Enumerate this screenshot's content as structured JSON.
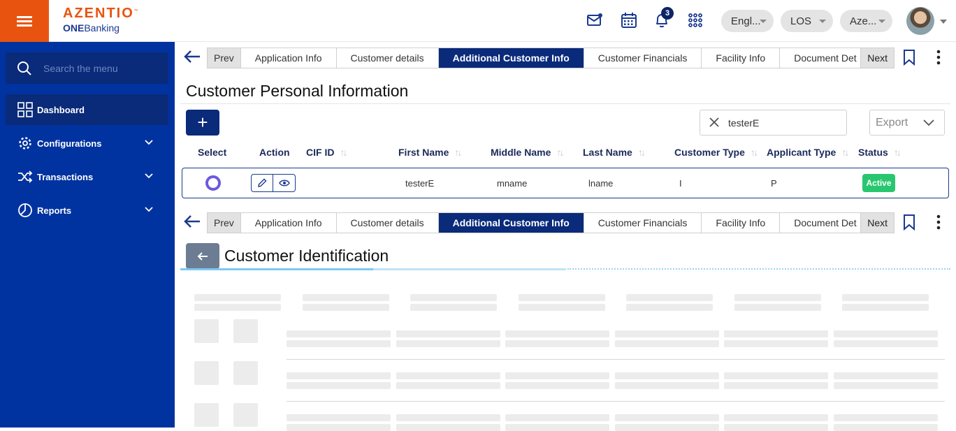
{
  "header": {
    "logo_brand": "AZENTIO",
    "logo_tm": "™",
    "logo_sub_bold": "ONE",
    "logo_sub": "Banking",
    "notification_count": "3",
    "language": "Engl...",
    "module": "LOS",
    "entity": "Aze..."
  },
  "sidebar": {
    "search_placeholder": "Search the menu",
    "items": [
      {
        "label": "Dashboard",
        "icon": "dashboard-icon"
      },
      {
        "label": "Configurations",
        "icon": "gear-icon"
      },
      {
        "label": "Transactions",
        "icon": "shuffle-icon"
      },
      {
        "label": "Reports",
        "icon": "pie-chart-icon"
      }
    ]
  },
  "tabs": {
    "prev": "Prev",
    "next": "Next",
    "items": [
      "Application Info",
      "Customer details",
      "Additional Customer Info",
      "Customer Financials",
      "Facility Info",
      "Document Det"
    ],
    "active": "Additional Customer Info"
  },
  "personal": {
    "title": "Customer Personal Information",
    "add_label": "+",
    "filter_value": "testerE",
    "export_label": "Export",
    "columns": [
      "Select",
      "Action",
      "CIF ID",
      "First Name",
      "Middle Name",
      "Last Name",
      "Customer Type",
      "Applicant Type",
      "Status"
    ],
    "rows": [
      {
        "cif_id": "",
        "first_name": "testerE",
        "middle_name": "mname",
        "last_name": "lname",
        "customer_type": "I",
        "applicant_type": "P",
        "status": "Active"
      }
    ]
  },
  "identification": {
    "title": "Customer Identification"
  },
  "colors": {
    "sidebar": "#0033a0",
    "accent_orange": "#e8540f",
    "active_tab": "#0a2a7a",
    "status_active": "#28c76f"
  }
}
